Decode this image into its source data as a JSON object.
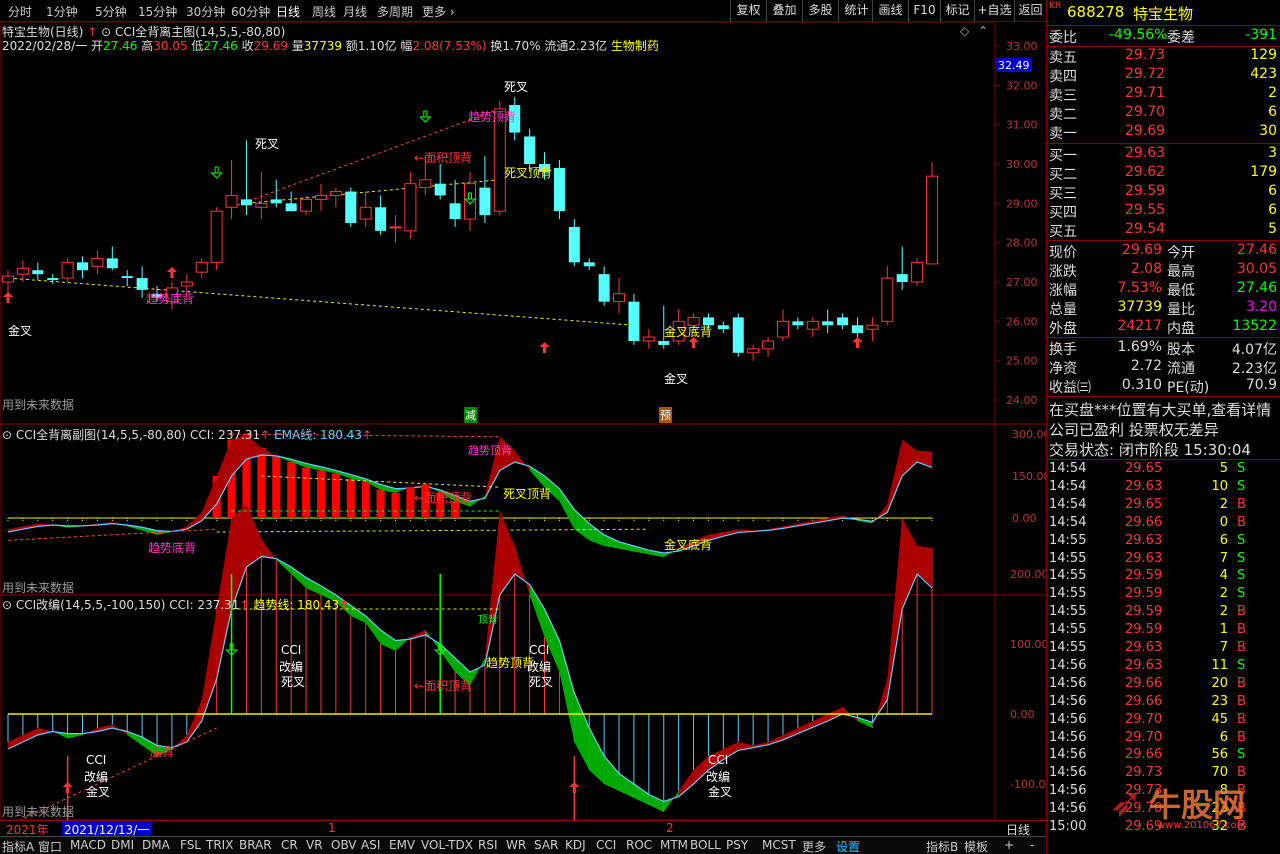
{
  "topbar": {
    "tabs": [
      "分时",
      "1分钟",
      "5分钟",
      "15分钟",
      "30分钟",
      "60分钟",
      "日线",
      "周线",
      "月线",
      "多周期",
      "更多"
    ],
    "active": "日线",
    "right_buttons": [
      "复权",
      "叠加",
      "多股",
      "统计",
      "画线",
      "F10",
      "标记",
      "+自选",
      "返回"
    ]
  },
  "main": {
    "title": "特宝生物(日线)",
    "indicator": "CCI全背离主图(14,5,5,-80,80)",
    "info": {
      "date": "2022/02/28/一",
      "open_label": "开",
      "open": "27.46",
      "high_label": "高",
      "high": "30.05",
      "low_label": "低",
      "low": "27.46",
      "close_label": "收",
      "close": "29.69",
      "vol_label": "量",
      "vol": "37739",
      "amt_label": "额",
      "amt": "1.10亿",
      "chg_label": "幅",
      "chg": "2.08(7.53%)",
      "turn_label": "换",
      "turn": "1.70%",
      "float_label": "流通",
      "float": "2.23亿",
      "sector": "生物制药"
    },
    "price_ticks": [
      "33.00",
      "32.00",
      "31.00",
      "30.00",
      "29.00",
      "28.00",
      "27.00",
      "26.00",
      "25.00",
      "24.00"
    ],
    "price_tag": "32.49",
    "annotations": {
      "dead1": "死叉",
      "dead2": "死叉",
      "gold1": "金叉",
      "gold2": "金叉",
      "trend_top": "趋势顶背",
      "area_top": "←面积顶背",
      "dead_top": "死叉顶背",
      "trend_bottom": "趋势底背",
      "gold_bottom": "金叉底背",
      "future": "用到未来数据",
      "jian": "减",
      "yu": "预"
    }
  },
  "sub1": {
    "title": "CCI全背离副图(14,5,5,-80,80)",
    "cci": "CCI: 237.31",
    "ema": "EMA线: 180.43",
    "ticks": [
      "300.00",
      "150.00",
      "0.00"
    ],
    "annotations": {
      "trend_top": "趋势顶背",
      "area_top": "←面积顶背",
      "dead_top": "死叉顶背",
      "trend_bottom": "趋势底背",
      "gold_bottom": "金叉底背",
      "future": "用到未来数据"
    }
  },
  "sub2": {
    "title": "CCI改编(14,5,5,-100,150)",
    "cci": "CCI: 237.31",
    "trend": "趋势线: 180.43",
    "ticks": [
      "200.00",
      "100.00",
      "0.00",
      "-100.00"
    ],
    "annotations": {
      "cci": "CCI",
      "gaibian": "改编",
      "dead": "死叉",
      "gold": "金叉",
      "area_top": "←面积顶背",
      "trend_top": "趋势顶背",
      "bottom": "底背",
      "future": "用到未来数据",
      "top_mark": "顶背"
    }
  },
  "timeaxis": {
    "year": "2021年",
    "cursor": "2021/12/13/一",
    "m1": "1",
    "m2": "2",
    "period": "日线"
  },
  "tabs": [
    "指标A",
    "窗口",
    "MACD",
    "DMI",
    "DMA",
    "FSL",
    "TRIX",
    "BRAR",
    "CR",
    "VR",
    "OBV",
    "ASI",
    "EMV",
    "VOL-TDX",
    "RSI",
    "WR",
    "SAR",
    "KDJ",
    "CCI",
    "ROC",
    "MTM",
    "BOLL",
    "PSY",
    "MCST",
    "更多",
    "设置"
  ],
  "tabs_right": [
    "指标B",
    "模板",
    "+",
    "-"
  ],
  "quote": {
    "market": "KR",
    "code": "688278",
    "name": "特宝生物",
    "weibi_label": "委比",
    "weibi": "-49.56%",
    "weicha_label": "委差",
    "weicha": "-391",
    "sells": [
      {
        "l": "卖五",
        "p": "29.73",
        "v": "129"
      },
      {
        "l": "卖四",
        "p": "29.72",
        "v": "423"
      },
      {
        "l": "卖三",
        "p": "29.71",
        "v": "2"
      },
      {
        "l": "卖二",
        "p": "29.70",
        "v": "6"
      },
      {
        "l": "卖一",
        "p": "29.69",
        "v": "30"
      }
    ],
    "buys": [
      {
        "l": "买一",
        "p": "29.63",
        "v": "3"
      },
      {
        "l": "买二",
        "p": "29.62",
        "v": "179"
      },
      {
        "l": "买三",
        "p": "29.59",
        "v": "6"
      },
      {
        "l": "买四",
        "p": "29.55",
        "v": "6"
      },
      {
        "l": "买五",
        "p": "29.54",
        "v": "5"
      }
    ],
    "stats": [
      {
        "a": "现价",
        "av": "29.69",
        "b": "今开",
        "bv": "27.46"
      },
      {
        "a": "涨跌",
        "av": "2.08",
        "b": "最高",
        "bv": "30.05"
      },
      {
        "a": "涨幅",
        "av": "7.53%",
        "b": "最低",
        "bv": "27.46"
      },
      {
        "a": "总量",
        "av": "37739",
        "b": "量比",
        "bv": "3.20"
      },
      {
        "a": "外盘",
        "av": "24217",
        "b": "内盘",
        "bv": "13522"
      }
    ],
    "stats2": [
      {
        "a": "换手",
        "av": "1.69%",
        "b": "股本",
        "bv": "4.07亿"
      },
      {
        "a": "净资",
        "av": "2.72",
        "b": "流通",
        "bv": "2.23亿"
      },
      {
        "a": "收益㈢",
        "av": "0.310",
        "b": "PE(动)",
        "bv": "70.9"
      }
    ],
    "news1": "在买盘***位置有大买单,查看详情",
    "news2": "公司已盈利 投票权无差异",
    "status": "交易状态: 闭市阶段 15:30:04",
    "ticks": [
      [
        "14:54",
        "29.65",
        "5",
        "S"
      ],
      [
        "14:54",
        "29.63",
        "10",
        "S"
      ],
      [
        "14:54",
        "29.65",
        "2",
        "B"
      ],
      [
        "14:54",
        "29.66",
        "0",
        "B"
      ],
      [
        "14:55",
        "29.63",
        "6",
        "S"
      ],
      [
        "14:55",
        "29.63",
        "7",
        "S"
      ],
      [
        "14:55",
        "29.59",
        "4",
        "S"
      ],
      [
        "14:55",
        "29.59",
        "2",
        "S"
      ],
      [
        "14:55",
        "29.59",
        "2",
        "B"
      ],
      [
        "14:55",
        "29.59",
        "1",
        "B"
      ],
      [
        "14:55",
        "29.63",
        "7",
        "B"
      ],
      [
        "14:56",
        "29.63",
        "11",
        "S"
      ],
      [
        "14:56",
        "29.66",
        "20",
        "B"
      ],
      [
        "14:56",
        "29.66",
        "23",
        "B"
      ],
      [
        "14:56",
        "29.70",
        "45",
        "B"
      ],
      [
        "14:56",
        "29.70",
        "6",
        "B"
      ],
      [
        "14:56",
        "29.66",
        "56",
        "S"
      ],
      [
        "14:56",
        "29.73",
        "70",
        "B"
      ],
      [
        "14:56",
        "29.73",
        "8",
        "B"
      ],
      [
        "14:56",
        "29.70",
        "23",
        "B"
      ],
      [
        "15:00",
        "29.69",
        "32",
        "B"
      ]
    ],
    "watermark": "牛股网",
    "watermark_url": "www.201062.com"
  },
  "chart_data": {
    "type": "candlestick",
    "note_series": "daily OHLC approximated",
    "candles": [
      [
        27.0,
        27.3,
        26.7,
        27.15
      ],
      [
        27.2,
        27.55,
        27.0,
        27.35
      ],
      [
        27.3,
        27.5,
        27.05,
        27.2
      ],
      [
        27.1,
        27.2,
        26.95,
        27.05
      ],
      [
        27.1,
        27.6,
        27.0,
        27.5
      ],
      [
        27.5,
        27.65,
        27.1,
        27.3
      ],
      [
        27.4,
        27.8,
        27.2,
        27.6
      ],
      [
        27.6,
        27.9,
        27.3,
        27.35
      ],
      [
        27.15,
        27.3,
        26.9,
        27.1
      ],
      [
        27.1,
        27.4,
        26.6,
        26.8
      ],
      [
        26.7,
        26.9,
        26.5,
        26.6
      ],
      [
        26.5,
        27.0,
        26.3,
        26.85
      ],
      [
        26.9,
        27.2,
        26.7,
        27.0
      ],
      [
        27.25,
        27.6,
        27.1,
        27.5
      ],
      [
        27.5,
        28.9,
        27.3,
        28.8
      ],
      [
        28.9,
        30.1,
        28.6,
        29.2
      ],
      [
        29.1,
        30.6,
        28.7,
        28.95
      ],
      [
        28.9,
        29.8,
        28.6,
        29.0
      ],
      [
        29.1,
        29.6,
        28.9,
        29.0
      ],
      [
        29.0,
        29.3,
        28.8,
        28.8
      ],
      [
        28.8,
        29.2,
        28.7,
        29.1
      ],
      [
        29.1,
        29.5,
        28.8,
        29.2
      ],
      [
        29.2,
        29.4,
        28.9,
        29.3
      ],
      [
        29.3,
        29.4,
        28.4,
        28.5
      ],
      [
        28.6,
        29.3,
        28.4,
        28.9
      ],
      [
        28.9,
        29.2,
        28.2,
        28.3
      ],
      [
        28.4,
        28.7,
        28.0,
        28.4
      ],
      [
        28.3,
        29.8,
        28.1,
        29.5
      ],
      [
        29.4,
        30.2,
        29.2,
        29.6
      ],
      [
        29.5,
        30.0,
        29.1,
        29.2
      ],
      [
        29.0,
        29.6,
        28.4,
        28.6
      ],
      [
        28.6,
        29.8,
        28.3,
        29.5
      ],
      [
        29.4,
        30.2,
        28.5,
        28.7
      ],
      [
        28.8,
        31.6,
        28.7,
        31.4
      ],
      [
        31.5,
        31.7,
        30.6,
        30.8
      ],
      [
        30.7,
        30.9,
        29.8,
        30.0
      ],
      [
        30.0,
        30.3,
        29.6,
        29.8
      ],
      [
        29.9,
        30.1,
        28.6,
        28.8
      ],
      [
        28.4,
        28.6,
        27.4,
        27.5
      ],
      [
        27.5,
        27.6,
        27.3,
        27.4
      ],
      [
        27.2,
        27.4,
        26.4,
        26.5
      ],
      [
        26.5,
        27.1,
        26.2,
        26.7
      ],
      [
        26.5,
        26.7,
        25.4,
        25.5
      ],
      [
        25.5,
        25.8,
        25.3,
        25.6
      ],
      [
        25.5,
        26.4,
        25.3,
        25.4
      ],
      [
        25.5,
        26.3,
        25.4,
        26.0
      ],
      [
        25.9,
        26.2,
        25.7,
        26.1
      ],
      [
        26.1,
        26.2,
        25.8,
        25.9
      ],
      [
        25.9,
        26.0,
        25.7,
        25.8
      ],
      [
        26.1,
        26.2,
        25.1,
        25.2
      ],
      [
        25.2,
        25.4,
        25.0,
        25.3
      ],
      [
        25.3,
        25.6,
        25.1,
        25.5
      ],
      [
        25.6,
        26.3,
        25.5,
        26.0
      ],
      [
        26.0,
        26.1,
        25.8,
        25.9
      ],
      [
        25.8,
        26.1,
        25.6,
        26.0
      ],
      [
        26.0,
        26.3,
        25.7,
        25.9
      ],
      [
        26.1,
        26.2,
        25.8,
        25.9
      ],
      [
        25.9,
        26.1,
        25.5,
        25.7
      ],
      [
        25.8,
        26.1,
        25.5,
        25.9
      ],
      [
        26.0,
        27.4,
        25.9,
        27.1
      ],
      [
        27.2,
        27.9,
        26.8,
        27.0
      ],
      [
        27.0,
        27.6,
        26.9,
        27.5
      ],
      [
        27.46,
        30.05,
        27.46,
        29.69
      ]
    ],
    "cci": [
      -40,
      -30,
      -20,
      -25,
      -35,
      -30,
      -20,
      -15,
      -30,
      -45,
      -60,
      -50,
      -30,
      20,
      150,
      280,
      300,
      250,
      220,
      200,
      180,
      170,
      160,
      140,
      130,
      100,
      90,
      110,
      120,
      90,
      60,
      40,
      80,
      290,
      240,
      170,
      110,
      60,
      -40,
      -80,
      -100,
      -110,
      -120,
      -130,
      -140,
      -110,
      -80,
      -60,
      -50,
      -40,
      -45,
      -40,
      -30,
      -20,
      -10,
      0,
      10,
      -10,
      -20,
      50,
      280,
      240,
      237
    ],
    "ema": [
      -50,
      -40,
      -30,
      -25,
      -28,
      -28,
      -25,
      -20,
      -25,
      -33,
      -45,
      -48,
      -40,
      -10,
      50,
      150,
      210,
      225,
      222,
      210,
      195,
      183,
      170,
      155,
      140,
      120,
      105,
      107,
      113,
      100,
      80,
      60,
      70,
      170,
      200,
      185,
      150,
      105,
      30,
      -20,
      -60,
      -85,
      -100,
      -115,
      -125,
      -118,
      -100,
      -80,
      -65,
      -52,
      -48,
      -44,
      -37,
      -28,
      -19,
      -10,
      0,
      -5,
      -12,
      20,
      150,
      200,
      180
    ]
  }
}
